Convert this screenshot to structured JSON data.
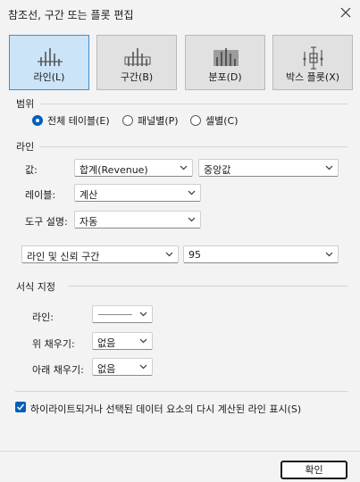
{
  "window": {
    "title": "참조선, 구간 또는 플롯 편집"
  },
  "types": [
    {
      "label": "라인(L)",
      "icon": "line-icon",
      "selected": true
    },
    {
      "label": "구간(B)",
      "icon": "band-icon",
      "selected": false
    },
    {
      "label": "분포(D)",
      "icon": "distribution-icon",
      "selected": false
    },
    {
      "label": "박스 플롯(X)",
      "icon": "box-plot-icon",
      "selected": false
    }
  ],
  "scope": {
    "title": "범위",
    "options": [
      {
        "label": "전체 테이블(E)",
        "selected": true
      },
      {
        "label": "패널별(P)",
        "selected": false
      },
      {
        "label": "셀별(C)",
        "selected": false
      }
    ]
  },
  "line": {
    "title": "라인",
    "value_label": "값:",
    "value_field": "합계(Revenue)",
    "value_agg": "중앙값",
    "label_label": "레이블:",
    "label_value": "계산",
    "tooltip_label": "도구 설명:",
    "tooltip_value": "자동",
    "interval_type": "라인 및 신뢰 구간",
    "interval_value": "95"
  },
  "formatting": {
    "title": "서식 지정",
    "line_label": "라인:",
    "fill_above_label": "위 채우기:",
    "fill_above_value": "없음",
    "fill_below_label": "아래 채우기:",
    "fill_below_value": "없음"
  },
  "recalc": {
    "label": "하이라이트되거나 선택된 데이터 요소의 다시 계산된 라인 표시(S)",
    "checked": true
  },
  "buttons": {
    "ok": "확인"
  },
  "colors": {
    "accent": "#005fb8",
    "selected_bg": "#cce4f7",
    "selected_border": "#3d8fd6"
  }
}
